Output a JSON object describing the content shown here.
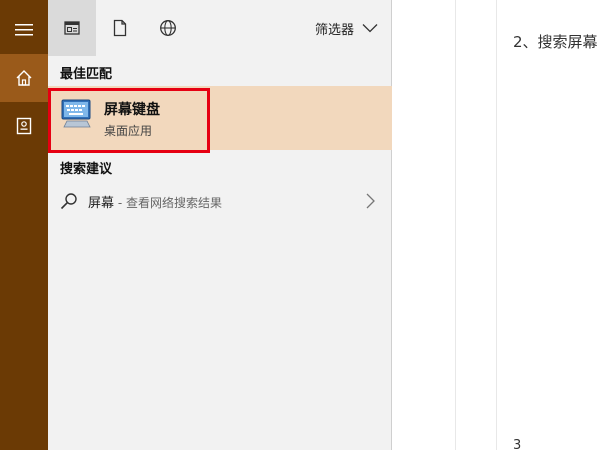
{
  "rail": {
    "items": [
      {
        "icon": "hamburger-menu-icon"
      },
      {
        "icon": "home-icon",
        "active": true
      },
      {
        "icon": "notebook-icon"
      }
    ]
  },
  "toolbar": {
    "tabs": [
      {
        "icon": "all-apps-icon",
        "active": true
      },
      {
        "icon": "document-icon"
      },
      {
        "icon": "web-globe-icon"
      }
    ],
    "filter_label": "筛选器",
    "filter_icon": "chevron-down-icon"
  },
  "best_match": {
    "section_title": "最佳匹配",
    "app_name": "屏幕键盘",
    "app_type": "桌面应用",
    "icon": "on-screen-keyboard-icon"
  },
  "suggestions": {
    "section_title": "搜索建议",
    "items": [
      {
        "query": "屏幕",
        "description": " - 查看网络搜索结果",
        "icon": "search-icon"
      }
    ]
  },
  "background_doc": {
    "line1": "2、搜索屏幕",
    "line2": "3"
  },
  "colors": {
    "rail_bg": "#6b3a05",
    "rail_active": "#9a5a1a",
    "panel_bg": "#f2f2f2",
    "selected_bg": "#f2d8bd",
    "highlight_border": "#e60012"
  }
}
